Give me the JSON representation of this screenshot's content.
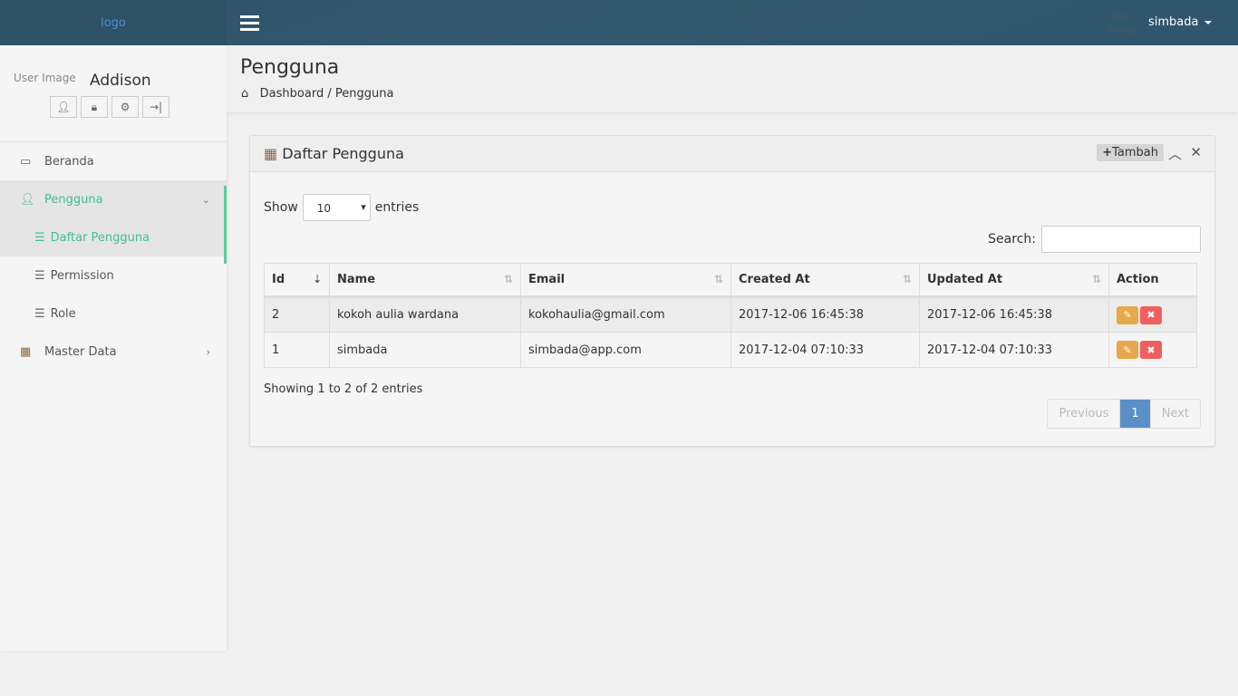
{
  "topbar": {
    "logo": "logo",
    "user_image_alt": "User Image",
    "username": "simbada"
  },
  "sidebar": {
    "user_image_alt": "User Image",
    "user_name": "Addison",
    "items": [
      {
        "label": "Beranda"
      },
      {
        "label": "Pengguna"
      },
      {
        "label": "Daftar Pengguna"
      },
      {
        "label": "Permission"
      },
      {
        "label": "Role"
      },
      {
        "label": "Master Data"
      }
    ]
  },
  "page": {
    "title": "Pengguna",
    "breadcrumb": [
      "Dashboard",
      "/",
      "Pengguna"
    ]
  },
  "panel": {
    "title": "Daftar Pengguna",
    "add_label": "Tambah",
    "show_label": "Show",
    "entries_label": "entries",
    "page_length": "10",
    "search_label": "Search:",
    "search_value": "",
    "columns": [
      "Id",
      "Name",
      "Email",
      "Created At",
      "Updated At",
      "Action"
    ],
    "rows": [
      {
        "id": "2",
        "name": "kokoh aulia wardana",
        "email": "kokohaulia@gmail.com",
        "created": "2017-12-06 16:45:38",
        "updated": "2017-12-06 16:45:38"
      },
      {
        "id": "1",
        "name": "simbada",
        "email": "simbada@app.com",
        "created": "2017-12-04 07:10:33",
        "updated": "2017-12-04 07:10:33"
      }
    ],
    "info": "Showing 1 to 2 of 2 entries",
    "pager": {
      "prev": "Previous",
      "current": "1",
      "next": "Next"
    }
  },
  "colors": {
    "accent": "#3fbf8f",
    "edit": "#e8a74b",
    "delete": "#f05f5f",
    "topbar": "#2d5166"
  }
}
